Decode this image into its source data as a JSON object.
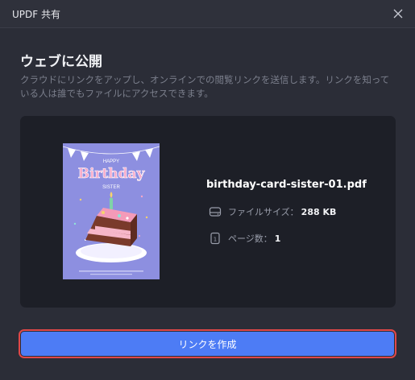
{
  "window": {
    "title": "UPDF 共有"
  },
  "panel": {
    "heading": "ウェブに公開",
    "description": "クラウドにリンクをアップし、オンラインでの閲覧リンクを送信します。リンクを知っている人は誰でもファイルにアクセスできます。"
  },
  "file": {
    "name": "birthday-card-sister-01.pdf",
    "size_label": "ファイルサイズ：",
    "size_value": "288 KB",
    "pages_label": "ページ数：",
    "pages_value": "1",
    "thumbnail": {
      "line1": "HAPPY",
      "line2": "Birthday",
      "line3": "SISTER"
    }
  },
  "actions": {
    "create_link": "リンクを作成"
  },
  "icons": {
    "close": "close-icon",
    "drive": "drive-icon",
    "page": "page-icon"
  },
  "colors": {
    "background": "#2b2d37",
    "card": "#1d1f27",
    "accent": "#4d7cf5",
    "highlight_border": "#e04848",
    "thumbnail_bg": "#8d8fe0"
  }
}
